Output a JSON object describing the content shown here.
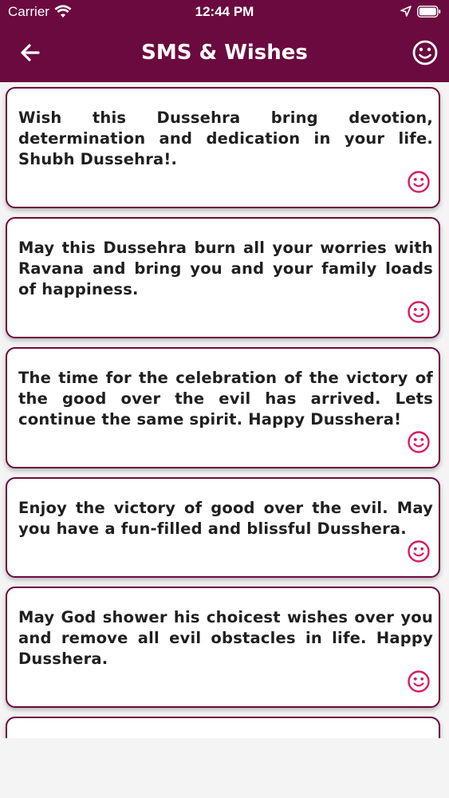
{
  "status_bar": {
    "carrier": "Carrier",
    "time": "12:44 PM",
    "icons": [
      "wifi-icon",
      "location-arrow-icon",
      "battery-icon"
    ]
  },
  "nav": {
    "title": "SMS & Wishes",
    "back_icon": "back-arrow-icon",
    "right_icon": "smiley-icon"
  },
  "theme": {
    "primary": "#6b0a3e",
    "accent": "#d81b60",
    "card_bg": "#ffffff",
    "page_bg": "#f4f4f4"
  },
  "messages": [
    {
      "text": "Wish this Dussehra bring devotion, determination and dedication in your life. Shubh Dussehra!.",
      "icon": "smiley-icon"
    },
    {
      "text": "May this Dussehra burn all your worries with Ravana and bring you and your family loads of happiness.",
      "icon": "smiley-icon"
    },
    {
      "text": "The time for the celebration of the victory of the good over the evil has arrived. Lets continue the same spirit. Happy Dusshera!",
      "icon": "smiley-icon"
    },
    {
      "text": "Enjoy the victory of good over the evil. May you have a fun-filled and blissful Dusshera.",
      "icon": "smiley-icon"
    },
    {
      "text": " May God shower his choicest wishes over you and remove all evil obstacles in life. Happy Dusshera.",
      "icon": "smiley-icon"
    },
    {
      "text": "",
      "icon": "smiley-icon"
    }
  ]
}
